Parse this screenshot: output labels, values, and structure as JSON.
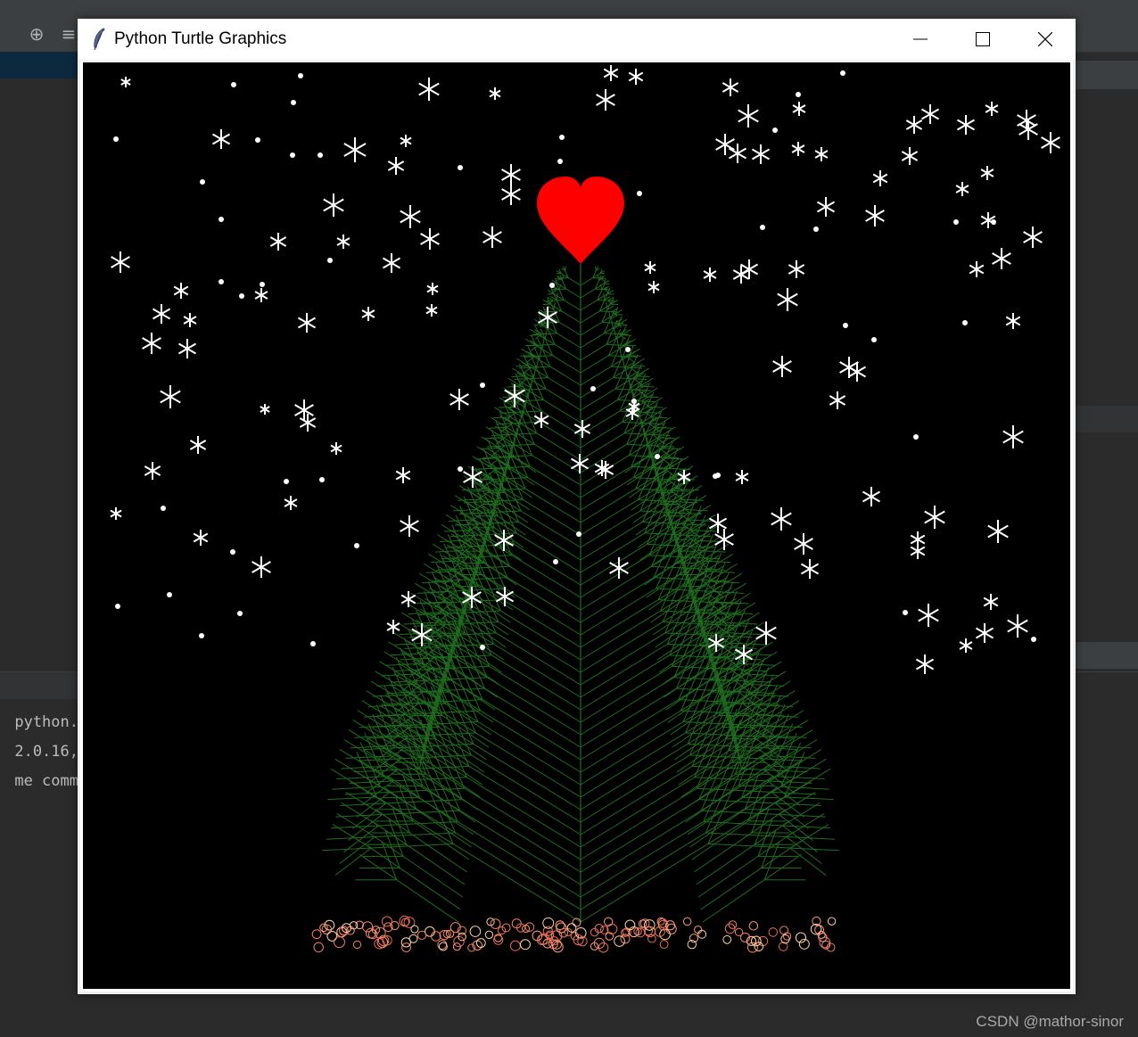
{
  "window": {
    "title": "Python Turtle Graphics",
    "icon": "feather-icon",
    "controls": [
      "minimize-icon",
      "maximize-icon",
      "close-icon"
    ]
  },
  "ide": {
    "toolbar_icons": [
      "crosshair-icon",
      "align-icon"
    ],
    "console_lines": [
      "python.",
      "2.0.16,",
      "me comm"
    ]
  },
  "watermark": "CSDN @mathor-sinor",
  "colors": {
    "canvas_bg": "#000000",
    "heart": "#ff0000",
    "tree": "#1f6e1f",
    "snow": "#ffffff",
    "ornaments": [
      "#f08060",
      "#ff9a7a",
      "#ffd2a0",
      "#e86a50"
    ]
  }
}
